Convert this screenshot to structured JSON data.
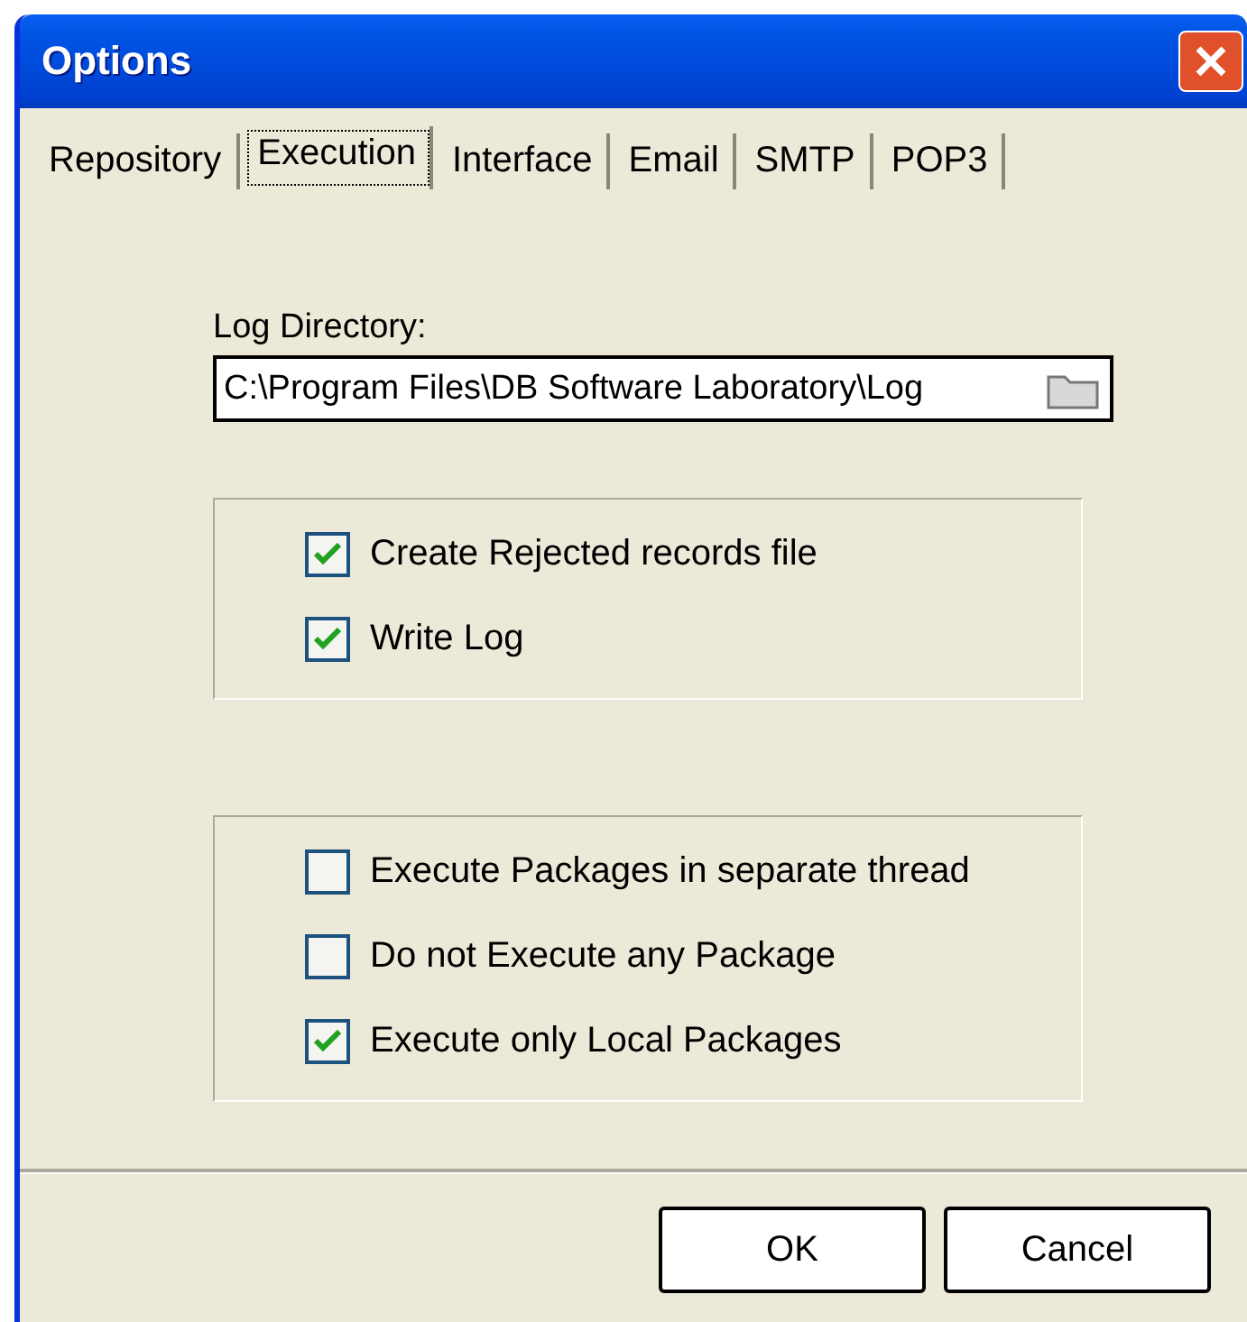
{
  "window": {
    "title": "Options"
  },
  "tabs": [
    {
      "label": "Repository",
      "selected": false
    },
    {
      "label": "Execution",
      "selected": true
    },
    {
      "label": "Interface",
      "selected": false
    },
    {
      "label": "Email",
      "selected": false
    },
    {
      "label": "SMTP",
      "selected": false
    },
    {
      "label": "POP3",
      "selected": false
    }
  ],
  "log_directory": {
    "label": "Log Directory:",
    "value": "C:\\Program Files\\DB Software Laboratory\\Log"
  },
  "groups": [
    [
      {
        "label": "Create Rejected records file",
        "checked": true
      },
      {
        "label": "Write Log",
        "checked": true
      }
    ],
    [
      {
        "label": "Execute Packages in separate thread",
        "checked": false
      },
      {
        "label": "Do not Execute any Package",
        "checked": false
      },
      {
        "label": "Execute only Local Packages",
        "checked": true
      }
    ]
  ],
  "buttons": [
    "OK",
    "Cancel"
  ]
}
